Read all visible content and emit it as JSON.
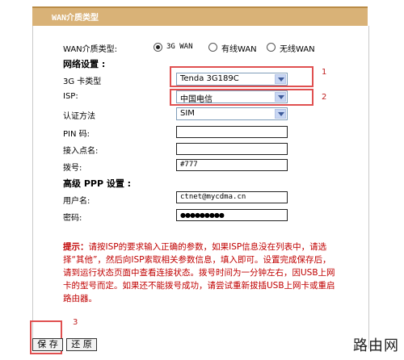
{
  "header": {
    "title": "WAN介质类型"
  },
  "wan_type": {
    "label": "WAN介质类型:",
    "options": [
      {
        "label": "3G WAN",
        "selected": true
      },
      {
        "label": "有线WAN",
        "selected": false
      },
      {
        "label": "无线WAN",
        "selected": false
      }
    ]
  },
  "network": {
    "section_label": "网络设置 :",
    "card_type": {
      "label": "3G 卡类型",
      "value": "Tenda 3G189C"
    },
    "isp": {
      "label": "ISP:",
      "value": "中国电信"
    },
    "auth": {
      "label": "认证方法",
      "value": "SIM"
    },
    "pin": {
      "label": "PIN 码:",
      "value": ""
    },
    "apn": {
      "label": "接入点名:",
      "value": ""
    },
    "dial": {
      "label": "拨号:",
      "value": "#777"
    }
  },
  "ppp": {
    "section_label": "高级 PPP 设置 :",
    "username": {
      "label": "用户名:",
      "value": "ctnet@mycdma.cn"
    },
    "password": {
      "label": "密码:",
      "value": "●●●●●●●●●"
    }
  },
  "annotations": {
    "one": "1",
    "two": "2",
    "three": "3"
  },
  "notice": {
    "prefix": "提示：",
    "text": "请按ISP的要求输入正确的参数，如果ISP信息没在列表中，请选择“其他”，然后向ISP索取相关参数信息，填入即可。设置完成保存后，请到运行状态页面中查看连接状态。拨号时间为一分钟左右，因USB上网卡的型号而定。如果还不能拨号成功，请尝试重新拔插USB上网卡或重启路由器。"
  },
  "buttons": {
    "save": "保 存",
    "restore": "还 原"
  },
  "watermark": "路由网",
  "colors": {
    "title_bar": "#d9b277",
    "highlight": "#e05050",
    "notice": "#c00000"
  }
}
